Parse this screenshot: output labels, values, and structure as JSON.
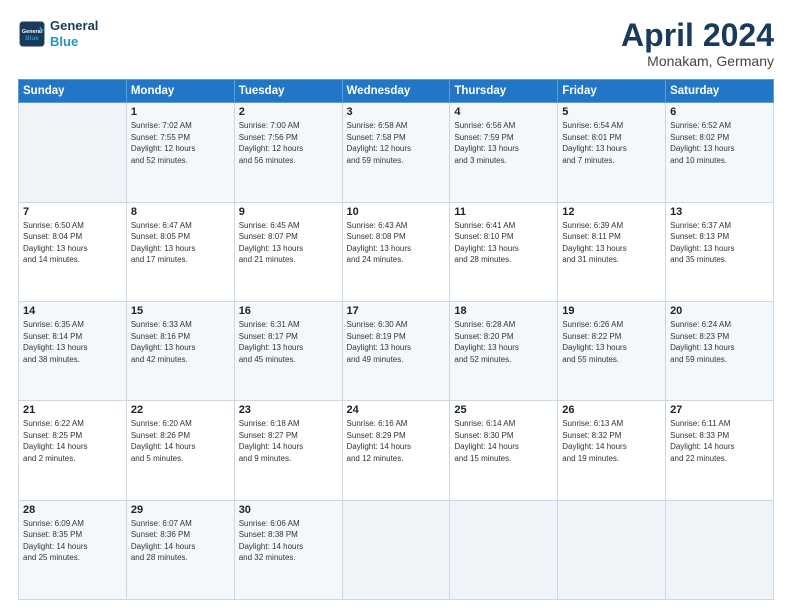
{
  "header": {
    "logo_line1": "General",
    "logo_line2": "Blue",
    "month_title": "April 2024",
    "location": "Monakam, Germany"
  },
  "weekdays": [
    "Sunday",
    "Monday",
    "Tuesday",
    "Wednesday",
    "Thursday",
    "Friday",
    "Saturday"
  ],
  "weeks": [
    [
      {
        "day": "",
        "info": ""
      },
      {
        "day": "1",
        "info": "Sunrise: 7:02 AM\nSunset: 7:55 PM\nDaylight: 12 hours\nand 52 minutes."
      },
      {
        "day": "2",
        "info": "Sunrise: 7:00 AM\nSunset: 7:56 PM\nDaylight: 12 hours\nand 56 minutes."
      },
      {
        "day": "3",
        "info": "Sunrise: 6:58 AM\nSunset: 7:58 PM\nDaylight: 12 hours\nand 59 minutes."
      },
      {
        "day": "4",
        "info": "Sunrise: 6:56 AM\nSunset: 7:59 PM\nDaylight: 13 hours\nand 3 minutes."
      },
      {
        "day": "5",
        "info": "Sunrise: 6:54 AM\nSunset: 8:01 PM\nDaylight: 13 hours\nand 7 minutes."
      },
      {
        "day": "6",
        "info": "Sunrise: 6:52 AM\nSunset: 8:02 PM\nDaylight: 13 hours\nand 10 minutes."
      }
    ],
    [
      {
        "day": "7",
        "info": "Sunrise: 6:50 AM\nSunset: 8:04 PM\nDaylight: 13 hours\nand 14 minutes."
      },
      {
        "day": "8",
        "info": "Sunrise: 6:47 AM\nSunset: 8:05 PM\nDaylight: 13 hours\nand 17 minutes."
      },
      {
        "day": "9",
        "info": "Sunrise: 6:45 AM\nSunset: 8:07 PM\nDaylight: 13 hours\nand 21 minutes."
      },
      {
        "day": "10",
        "info": "Sunrise: 6:43 AM\nSunset: 8:08 PM\nDaylight: 13 hours\nand 24 minutes."
      },
      {
        "day": "11",
        "info": "Sunrise: 6:41 AM\nSunset: 8:10 PM\nDaylight: 13 hours\nand 28 minutes."
      },
      {
        "day": "12",
        "info": "Sunrise: 6:39 AM\nSunset: 8:11 PM\nDaylight: 13 hours\nand 31 minutes."
      },
      {
        "day": "13",
        "info": "Sunrise: 6:37 AM\nSunset: 8:13 PM\nDaylight: 13 hours\nand 35 minutes."
      }
    ],
    [
      {
        "day": "14",
        "info": "Sunrise: 6:35 AM\nSunset: 8:14 PM\nDaylight: 13 hours\nand 38 minutes."
      },
      {
        "day": "15",
        "info": "Sunrise: 6:33 AM\nSunset: 8:16 PM\nDaylight: 13 hours\nand 42 minutes."
      },
      {
        "day": "16",
        "info": "Sunrise: 6:31 AM\nSunset: 8:17 PM\nDaylight: 13 hours\nand 45 minutes."
      },
      {
        "day": "17",
        "info": "Sunrise: 6:30 AM\nSunset: 8:19 PM\nDaylight: 13 hours\nand 49 minutes."
      },
      {
        "day": "18",
        "info": "Sunrise: 6:28 AM\nSunset: 8:20 PM\nDaylight: 13 hours\nand 52 minutes."
      },
      {
        "day": "19",
        "info": "Sunrise: 6:26 AM\nSunset: 8:22 PM\nDaylight: 13 hours\nand 55 minutes."
      },
      {
        "day": "20",
        "info": "Sunrise: 6:24 AM\nSunset: 8:23 PM\nDaylight: 13 hours\nand 59 minutes."
      }
    ],
    [
      {
        "day": "21",
        "info": "Sunrise: 6:22 AM\nSunset: 8:25 PM\nDaylight: 14 hours\nand 2 minutes."
      },
      {
        "day": "22",
        "info": "Sunrise: 6:20 AM\nSunset: 8:26 PM\nDaylight: 14 hours\nand 5 minutes."
      },
      {
        "day": "23",
        "info": "Sunrise: 6:18 AM\nSunset: 8:27 PM\nDaylight: 14 hours\nand 9 minutes."
      },
      {
        "day": "24",
        "info": "Sunrise: 6:16 AM\nSunset: 8:29 PM\nDaylight: 14 hours\nand 12 minutes."
      },
      {
        "day": "25",
        "info": "Sunrise: 6:14 AM\nSunset: 8:30 PM\nDaylight: 14 hours\nand 15 minutes."
      },
      {
        "day": "26",
        "info": "Sunrise: 6:13 AM\nSunset: 8:32 PM\nDaylight: 14 hours\nand 19 minutes."
      },
      {
        "day": "27",
        "info": "Sunrise: 6:11 AM\nSunset: 8:33 PM\nDaylight: 14 hours\nand 22 minutes."
      }
    ],
    [
      {
        "day": "28",
        "info": "Sunrise: 6:09 AM\nSunset: 8:35 PM\nDaylight: 14 hours\nand 25 minutes."
      },
      {
        "day": "29",
        "info": "Sunrise: 6:07 AM\nSunset: 8:36 PM\nDaylight: 14 hours\nand 28 minutes."
      },
      {
        "day": "30",
        "info": "Sunrise: 6:06 AM\nSunset: 8:38 PM\nDaylight: 14 hours\nand 32 minutes."
      },
      {
        "day": "",
        "info": ""
      },
      {
        "day": "",
        "info": ""
      },
      {
        "day": "",
        "info": ""
      },
      {
        "day": "",
        "info": ""
      }
    ]
  ]
}
